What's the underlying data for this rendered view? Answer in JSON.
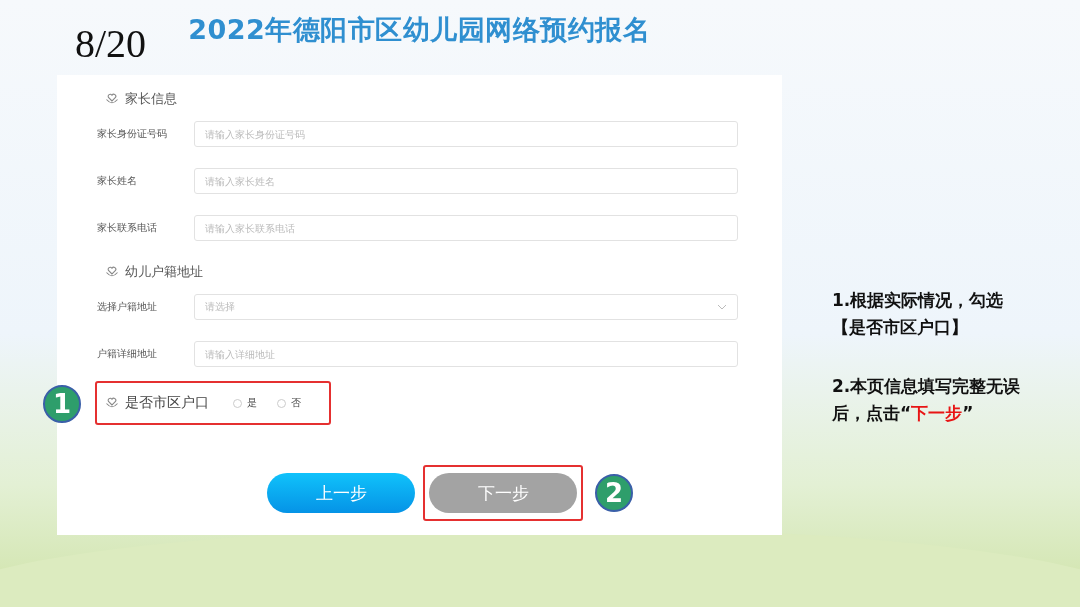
{
  "slide": {
    "page_number": "8/20",
    "title": "2022年德阳市区幼儿园网络预约报名"
  },
  "form": {
    "sections": [
      {
        "title": "家长信息",
        "fields": [
          {
            "kind": "text",
            "label": "家长身份证号码",
            "placeholder": "请输入家长身份证号码"
          },
          {
            "kind": "text",
            "label": "家长姓名",
            "placeholder": "请输入家长姓名"
          },
          {
            "kind": "text",
            "label": "家长联系电话",
            "placeholder": "请输入家长联系电话"
          }
        ]
      },
      {
        "title": "幼儿户籍地址",
        "fields": [
          {
            "kind": "select",
            "label": "选择户籍地址",
            "placeholder": "请选择"
          },
          {
            "kind": "text",
            "label": "户籍详细地址",
            "placeholder": "请输入详细地址"
          }
        ]
      }
    ],
    "hukou": {
      "title": "是否市区户口",
      "callout": "1",
      "options": [
        {
          "label": "是",
          "selected": false
        },
        {
          "label": "否",
          "selected": false
        }
      ]
    },
    "buttons": [
      {
        "label": "上一步",
        "kind": "primary"
      },
      {
        "label": "下一步",
        "kind": "disabled",
        "callout": "2"
      }
    ]
  },
  "instructions": [
    {
      "text": "1.根据实际情况，勾选【是否市区户口】"
    },
    {
      "text": "2.本页信息填写完整无误后，点击“",
      "highlight": "下一步",
      "end": "”"
    }
  ]
}
